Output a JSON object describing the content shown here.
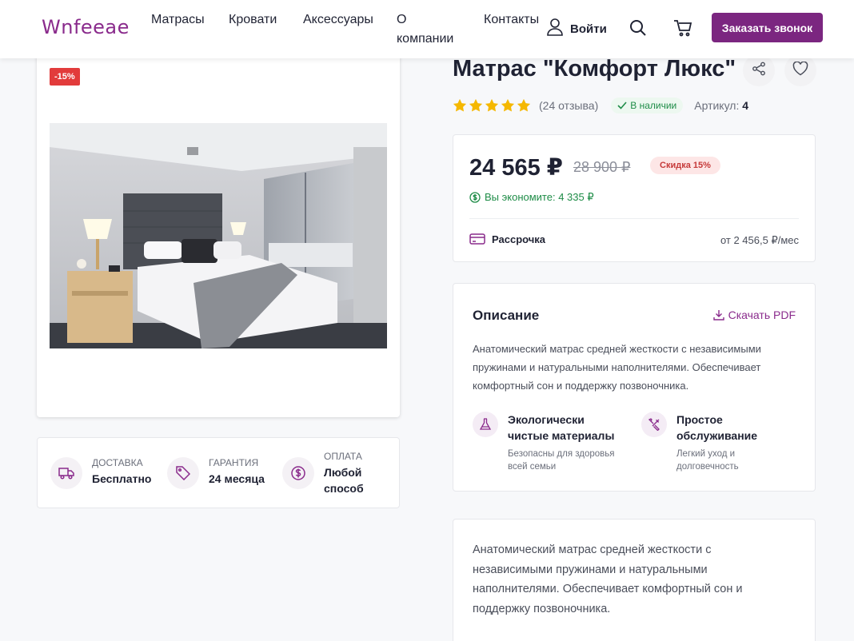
{
  "header": {
    "logo": "Wnfeeae",
    "nav": [
      "Матрасы",
      "Кровати",
      "Аксессуары",
      "О компании",
      "Контакты"
    ],
    "login_label": "Войти",
    "call_button": "Заказать звонок",
    "icons": [
      "user-icon",
      "search-icon",
      "cart-icon"
    ]
  },
  "gallery": {
    "discount_tag": "-15%"
  },
  "info": {
    "delivery": {
      "label": "Доставка",
      "value": "Бесплатно",
      "icon": "truck-icon"
    },
    "warranty": {
      "label": "Гарантия",
      "value": "24 месяца",
      "icon": "tag-icon"
    },
    "payment": {
      "label": "Оплата",
      "value": "Любой способ",
      "icon": "dollar-icon"
    }
  },
  "product": {
    "title": "Матрас \"Комфорт Люкс\"",
    "rating": 5,
    "reviews": "(24 отзыва)",
    "stock": "В наличии",
    "article_label": "Артикул:",
    "article_value": "4"
  },
  "price": {
    "current": "24 565 ₽",
    "old": "28 900 ₽",
    "badge": "Скидка 15%",
    "save": "Вы экономите: 4 335 ₽",
    "installment_label": "Рассрочка",
    "installment_price": "от 2 456,5 ₽/мес"
  },
  "description": {
    "title": "Описание",
    "pdf_label": "Скачать PDF",
    "text": "Анатомический матрас средней жесткости с независимыми пружинами и натуральными наполнителями. Обеспечивает комфортный сон и поддержку позвоночника.",
    "features": [
      {
        "title": "Экологически чистые материалы",
        "sub": "Безопасны для здоровья всей семьи",
        "icon": "flask-icon"
      },
      {
        "title": "Простое обслуживание",
        "sub": "Легкий уход и долговечность",
        "icon": "tools-icon"
      }
    ]
  },
  "long_text": "Анатомический матрас средней жесткости с независимыми пружинами и натуральными наполнителями. Обеспечивает комфортный сон и поддержку позвоночника.",
  "colors": {
    "brand": "#7b2680",
    "sale": "#e23b3b",
    "success": "#1e8c47",
    "star": "#f5b800"
  }
}
